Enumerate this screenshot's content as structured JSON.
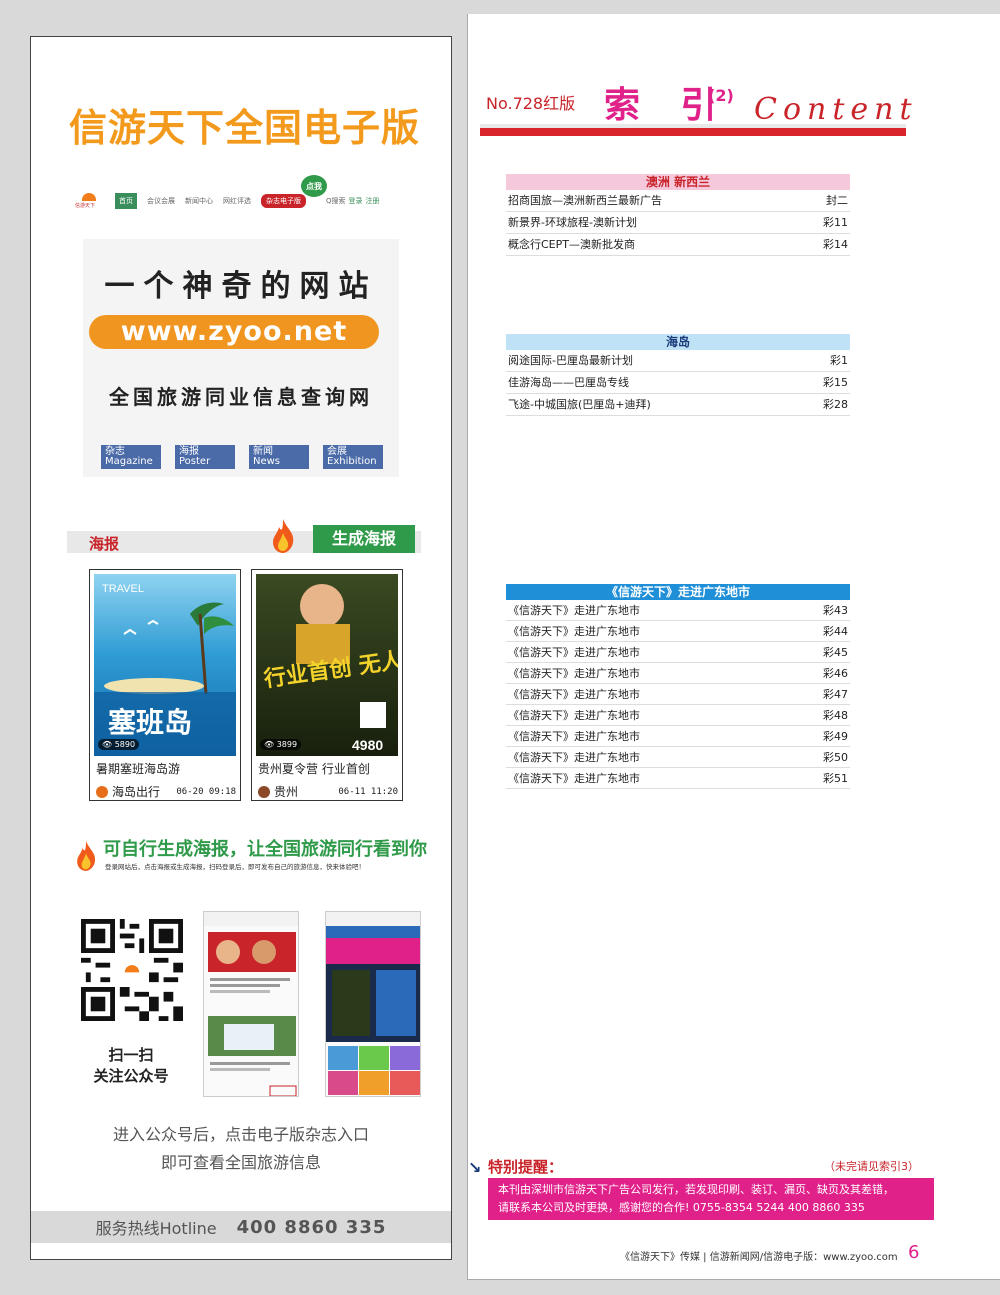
{
  "left": {
    "main_title": "信游天下全国电子版",
    "nav": {
      "logo_text": "信游天下",
      "items": [
        "首页",
        "会议会展",
        "新闻中心",
        "网红评选"
      ],
      "magazine": "杂志电子版",
      "dianwo": "点我",
      "search": "Q搜索",
      "login": "登录",
      "register": "注册"
    },
    "banner": {
      "headline": "一个神奇的网站",
      "url": "www.zyoo.net",
      "subline": "全国旅游同业信息查询网",
      "categories": [
        {
          "cn": "杂志",
          "en": "Magazine"
        },
        {
          "cn": "海报",
          "en": "Poster"
        },
        {
          "cn": "新闻",
          "en": "News"
        },
        {
          "cn": "会展",
          "en": "Exhibition"
        }
      ]
    },
    "haibao_label": "海报",
    "generate_button": "生成海报",
    "posters": [
      {
        "title": "暑期塞班海岛游",
        "publisher": "海岛出行",
        "time": "06-20 09:18",
        "views": "5890",
        "art_text": "塞班岛",
        "art_top": "TRAVEL"
      },
      {
        "title": "贵州夏令营 行业首创",
        "publisher": "贵州",
        "time": "06-11 11:20",
        "views": "3899",
        "art_text": "行业首创 无人可比",
        "price": "4980"
      }
    ],
    "promo_title": "可自行生成海报，让全国旅游同行看到你",
    "promo_sub": "登录网站后，点击海报或生成海报，扫码登录后，即可发布自己的旅游信息，快来体验吧！",
    "scan_line1": "扫一扫",
    "scan_line2": "关注公众号",
    "enter_line1": "进入公众号后，点击电子版杂志入口",
    "enter_line2": "即可查看全国旅游信息",
    "hotline_label": "服务热线Hotline",
    "hotline_number": "400 8860 335"
  },
  "right": {
    "issue": "No.728红版",
    "index_title": "索 引",
    "index_num": "(2)",
    "content_word": "Content",
    "sections": {
      "aus": {
        "head": "澳洲 新西兰",
        "rows": [
          {
            "name": "招商国旅—澳洲新西兰最新广告",
            "page": "封二"
          },
          {
            "name": "新景界-环球旅程-澳新计划",
            "page": "彩11"
          },
          {
            "name": "概念行CEPT—澳新批发商",
            "page": "彩14"
          }
        ]
      },
      "island": {
        "head": "海岛",
        "rows": [
          {
            "name": "阅途国际-巴厘岛最新计划",
            "page": "彩1"
          },
          {
            "name": "佳游海岛——巴厘岛专线",
            "page": "彩15"
          },
          {
            "name": "飞途-中城国旅(巴厘岛+迪拜)",
            "page": "彩28"
          }
        ]
      },
      "gd": {
        "head": "《信游天下》走进广东地市",
        "rows": [
          {
            "name": "《信游天下》走进广东地市",
            "page": "彩43"
          },
          {
            "name": "《信游天下》走进广东地市",
            "page": "彩44"
          },
          {
            "name": "《信游天下》走进广东地市",
            "page": "彩45"
          },
          {
            "name": "《信游天下》走进广东地市",
            "page": "彩46"
          },
          {
            "name": "《信游天下》走进广东地市",
            "page": "彩47"
          },
          {
            "name": "《信游天下》走进广东地市",
            "page": "彩48"
          },
          {
            "name": "《信游天下》走进广东地市",
            "page": "彩49"
          },
          {
            "name": "《信游天下》走进广东地市",
            "page": "彩50"
          },
          {
            "name": "《信游天下》走进广东地市",
            "page": "彩51"
          }
        ]
      }
    },
    "remind_title": "特别提醒：",
    "remind_note": "（未完请见索引3）",
    "remind_line1": "本刊由深圳市信游天下广告公司发行，若发现印刷、装订、漏页、缺页及其差错，",
    "remind_line2": "请联系本公司及时更换，感谢您的合作!   0755-8354 5244    400 8860 335",
    "footer": "《信游天下》传媒 | 信游新闻网/信游电子版：www.zyoo.com",
    "page_number": "6"
  },
  "colors": {
    "accent_pink": "#e0218a",
    "accent_red": "#c8242a",
    "accent_green": "#2f9a49",
    "accent_orange": "#f39a1d",
    "blue_head": "#1f8fd8"
  }
}
